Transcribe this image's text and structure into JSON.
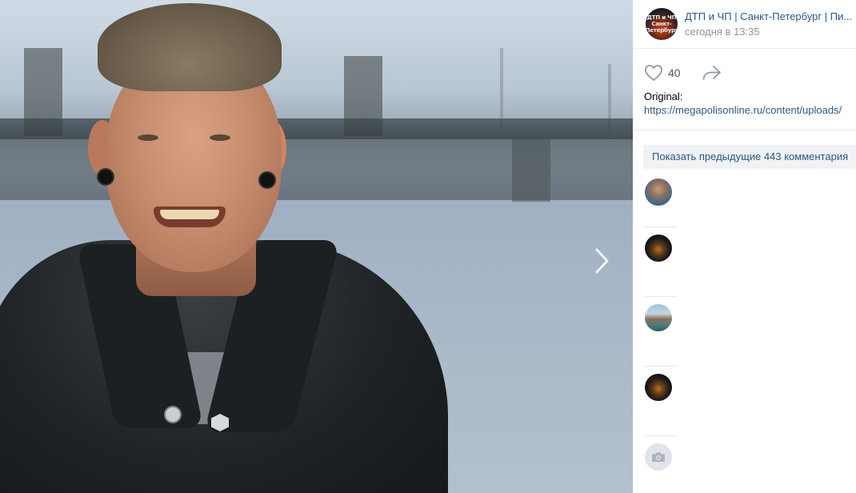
{
  "header": {
    "group_name": "ДТП и ЧП | Санкт-Петербург | Пи...",
    "avatar_text": "ДТП и ЧП Санкт-Петербург",
    "time": "сегодня в 13:35"
  },
  "actions": {
    "likes": "40"
  },
  "description": {
    "label": "Original:",
    "link": "https://megapolisonline.ru/content/uploads/"
  },
  "comments": {
    "show_prev": "Показать предыдущие 443 комментария"
  },
  "icons": {
    "next": "chevron-right-icon",
    "like": "heart-icon",
    "share": "share-arrow-icon",
    "no_photo": "camera-icon"
  },
  "colors": {
    "link": "#2a5885",
    "muted": "#939393",
    "button_bg": "#f0f2f5"
  }
}
